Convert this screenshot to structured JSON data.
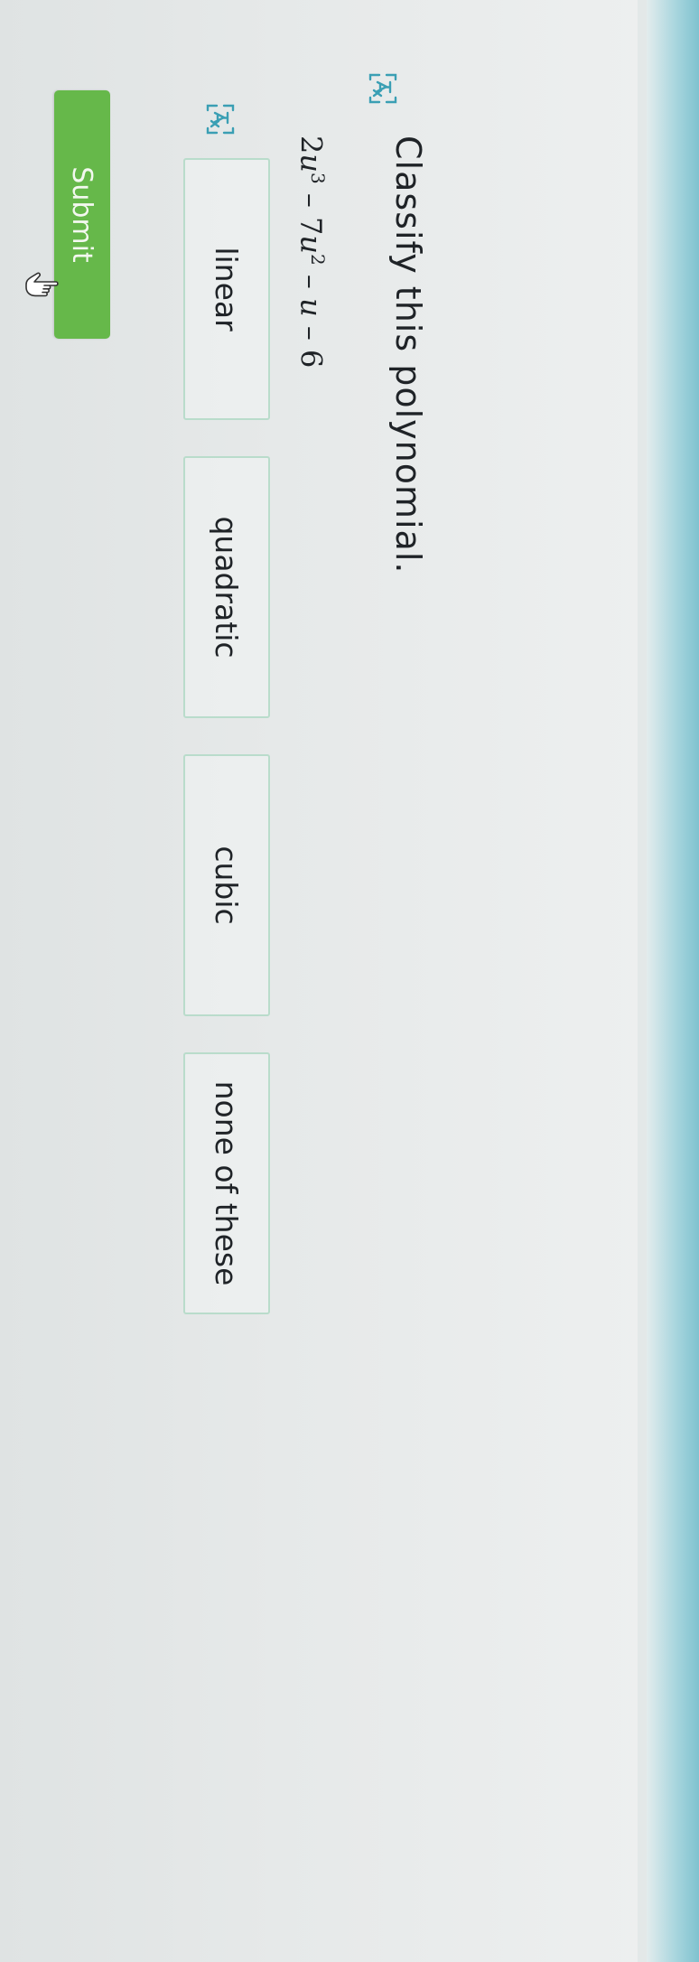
{
  "question": {
    "prompt": "Classify this polynomial.",
    "translate_icon": "translate-icon"
  },
  "expression": {
    "parts": [
      "2",
      "u",
      "3",
      " – 7",
      "u",
      "2",
      " – ",
      "u",
      " – 6"
    ]
  },
  "choices": [
    "linear",
    "quadratic",
    "cubic",
    "none of these"
  ],
  "submit": {
    "label": "Submit"
  },
  "cursor_icon": "hand-pointer-icon",
  "colors": {
    "accent": "#3a9fb4",
    "submit_bg": "#66b84a",
    "choice_border": "#b9dccb",
    "text": "#1f2327"
  }
}
